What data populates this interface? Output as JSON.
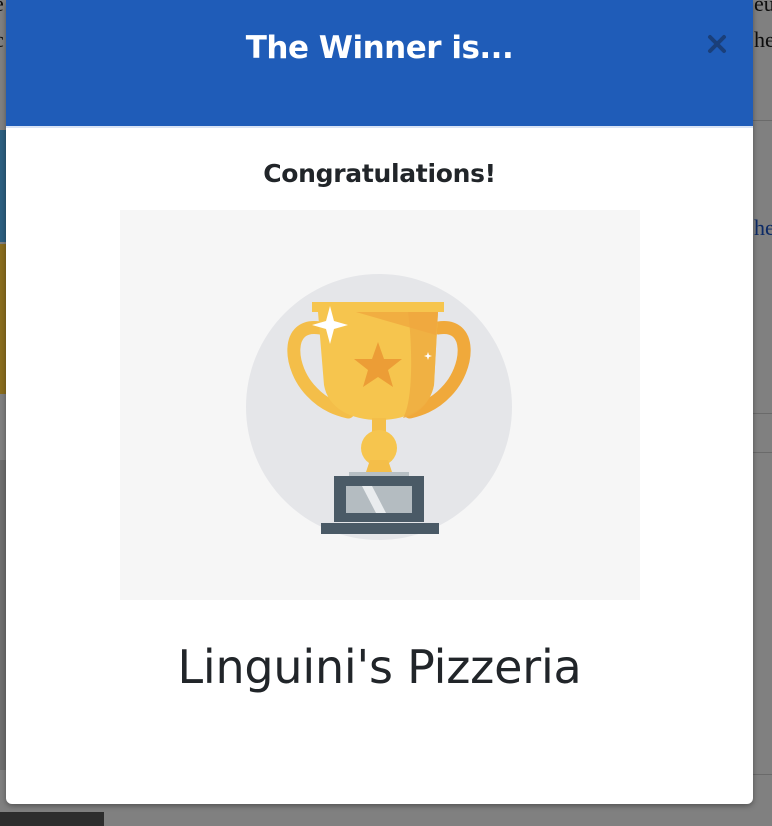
{
  "modal": {
    "title": "The Winner is...",
    "close_icon": "close-icon",
    "subtitle": "Congratulations!",
    "winner_name": "Linguini's Pizzeria",
    "image_icon": "trophy-icon"
  },
  "background": {
    "fragments": [
      "e",
      "eu",
      "c",
      "he",
      "he"
    ]
  },
  "colors": {
    "header": "#1f5cb8",
    "overlay": "#808080",
    "trophy_gold": "#f6c54e",
    "trophy_base": "#4a5a66"
  }
}
